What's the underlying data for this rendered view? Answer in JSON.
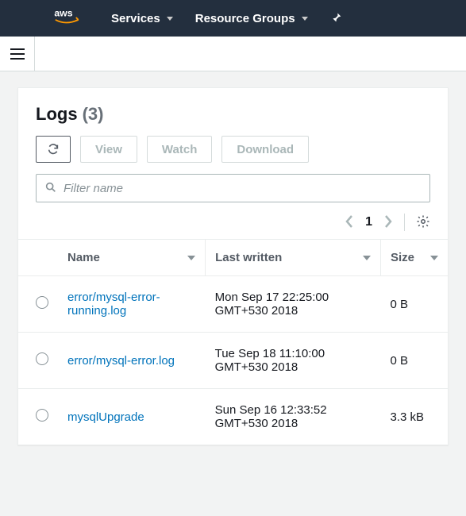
{
  "nav": {
    "services": "Services",
    "resource_groups": "Resource Groups"
  },
  "panel": {
    "title": "Logs",
    "count": "(3)"
  },
  "toolbar": {
    "view": "View",
    "watch": "Watch",
    "download": "Download"
  },
  "search": {
    "placeholder": "Filter name"
  },
  "pagination": {
    "page": "1"
  },
  "columns": {
    "name": "Name",
    "last_written": "Last written",
    "size": "Size"
  },
  "rows": [
    {
      "name": "error/mysql-error-running.log",
      "last_written": "Mon Sep 17 22:25:00 GMT+530 2018",
      "size": "0 B"
    },
    {
      "name": "error/mysql-error.log",
      "last_written": "Tue Sep 18 11:10:00 GMT+530 2018",
      "size": "0 B"
    },
    {
      "name": "mysqlUpgrade",
      "last_written": "Sun Sep 16 12:33:52 GMT+530 2018",
      "size": "3.3 kB"
    }
  ]
}
